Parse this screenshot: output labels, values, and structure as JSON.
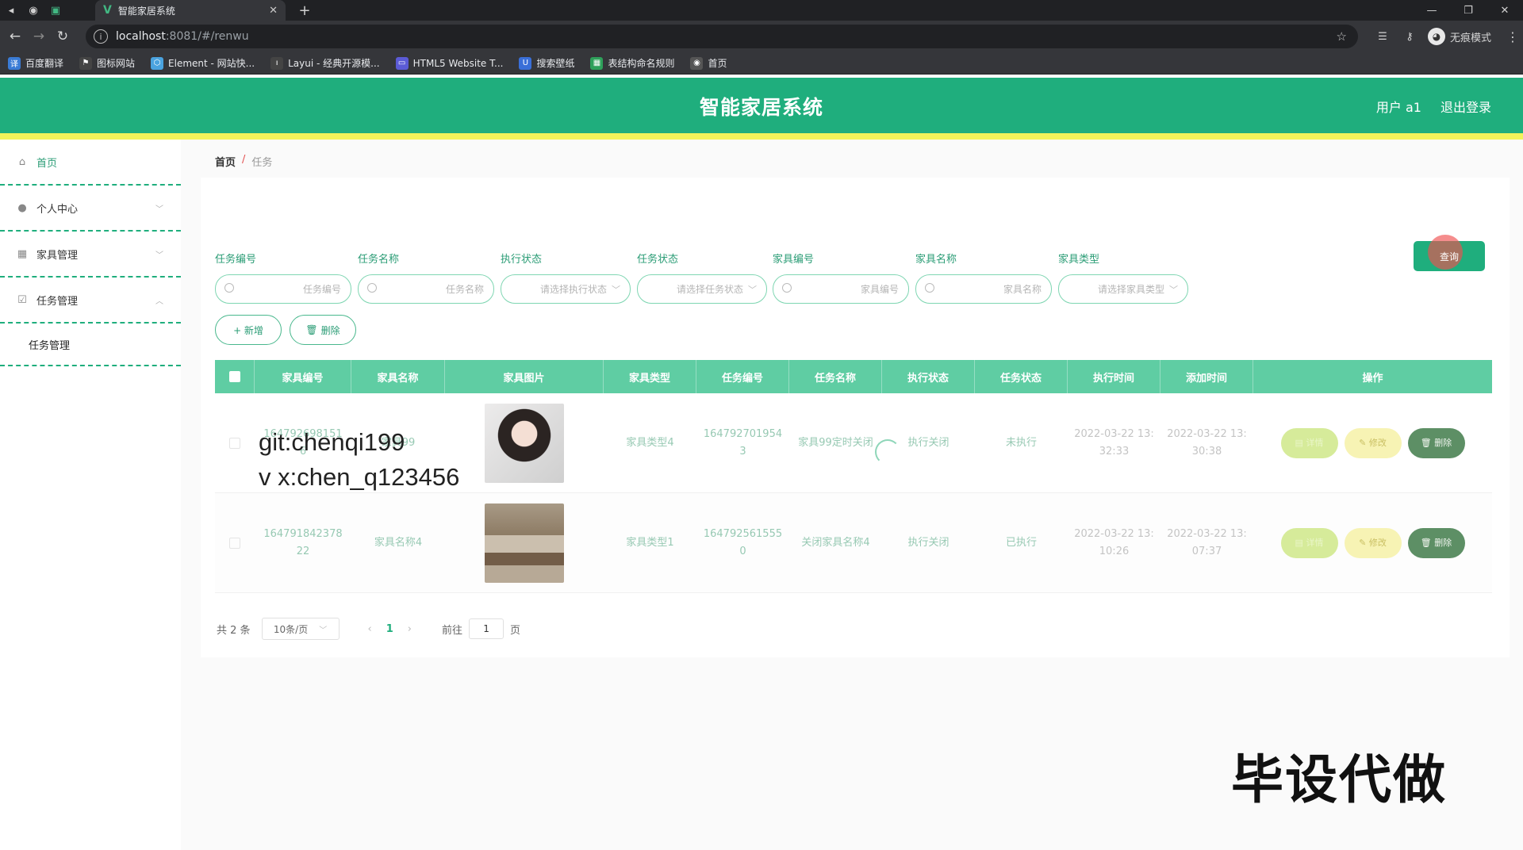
{
  "browser": {
    "tab_title": "智能家居系统",
    "address_host": "localhost",
    "address_path": ":8081/#/renwu",
    "profile_label": "无痕模式",
    "bookmarks": [
      {
        "label": "百度翻译",
        "color": "#3a7bd5"
      },
      {
        "label": "图标网站",
        "color": "#444444"
      },
      {
        "label": "Element - 网站快...",
        "color": "#4aa3df"
      },
      {
        "label": "Layui - 经典开源模...",
        "color": "#444444"
      },
      {
        "label": "HTML5 Website T...",
        "color": "#5b5bd6"
      },
      {
        "label": "搜索壁纸",
        "color": "#3a6fd8"
      },
      {
        "label": "表结构命名规则",
        "color": "#2ea05a"
      },
      {
        "label": "首页",
        "color": "#555555"
      }
    ]
  },
  "header": {
    "title": "智能家居系统",
    "user_label": "用户 a1",
    "logout_label": "退出登录"
  },
  "sidebar": {
    "home": "首页",
    "personal": "个人中心",
    "furniture": "家具管理",
    "task": "任务管理",
    "task_sub": "任务管理"
  },
  "breadcrumb": {
    "home": "首页",
    "sep": "/",
    "current": "任务"
  },
  "filters": {
    "task_no_label": "任务编号",
    "task_no_placeholder": "任务编号",
    "task_name_label": "任务名称",
    "task_name_placeholder": "任务名称",
    "exec_status_label": "执行状态",
    "exec_status_placeholder": "请选择执行状态",
    "task_status_label": "任务状态",
    "task_status_placeholder": "请选择任务状态",
    "furn_no_label": "家具编号",
    "furn_no_placeholder": "家具编号",
    "furn_name_label": "家具名称",
    "furn_name_placeholder": "家具名称",
    "furn_type_label": "家具类型",
    "furn_type_placeholder": "请选择家具类型",
    "query_label": "查询"
  },
  "actions": {
    "add_label": "+ 新增",
    "delete_label": "删除"
  },
  "table": {
    "headers": [
      "家具编号",
      "家具名称",
      "家具图片",
      "家具类型",
      "任务编号",
      "任务名称",
      "执行状态",
      "任务状态",
      "执行时间",
      "添加时间",
      "操作"
    ],
    "rows": [
      {
        "furn_no": "1647926981516",
        "furn_name": "家具99",
        "furn_type": "家具类型4",
        "task_no": "1647927019543",
        "task_name": "家具99定时关闭",
        "exec_status": "执行关闭",
        "task_status": "未执行",
        "exec_time": "2022-03-22 13:32:33",
        "add_time": "2022-03-22 13:30:38"
      },
      {
        "furn_no": "164791842378 22",
        "furn_name": "家具名称4",
        "furn_type": "家具类型1",
        "task_no": "1647925615550",
        "task_name": "关闭家具名称4",
        "exec_status": "执行关闭",
        "task_status": "已执行",
        "exec_time": "2022-03-22 13:10:26",
        "add_time": "2022-03-22 13:07:37"
      }
    ],
    "op_detail": "详情",
    "op_edit": "修改",
    "op_delete": "删除"
  },
  "pagination": {
    "total": "共 2 条",
    "page_size": "10条/页",
    "current_page": "1",
    "goto_label": "前往",
    "goto_value": "1",
    "page_unit": "页"
  },
  "overlays": {
    "git": "git:chenqi199",
    "vx": "v x:chen_q123456",
    "watermark": "毕设代做"
  },
  "colors": {
    "primary": "#1fae7d",
    "strip": "#f1f35a"
  }
}
